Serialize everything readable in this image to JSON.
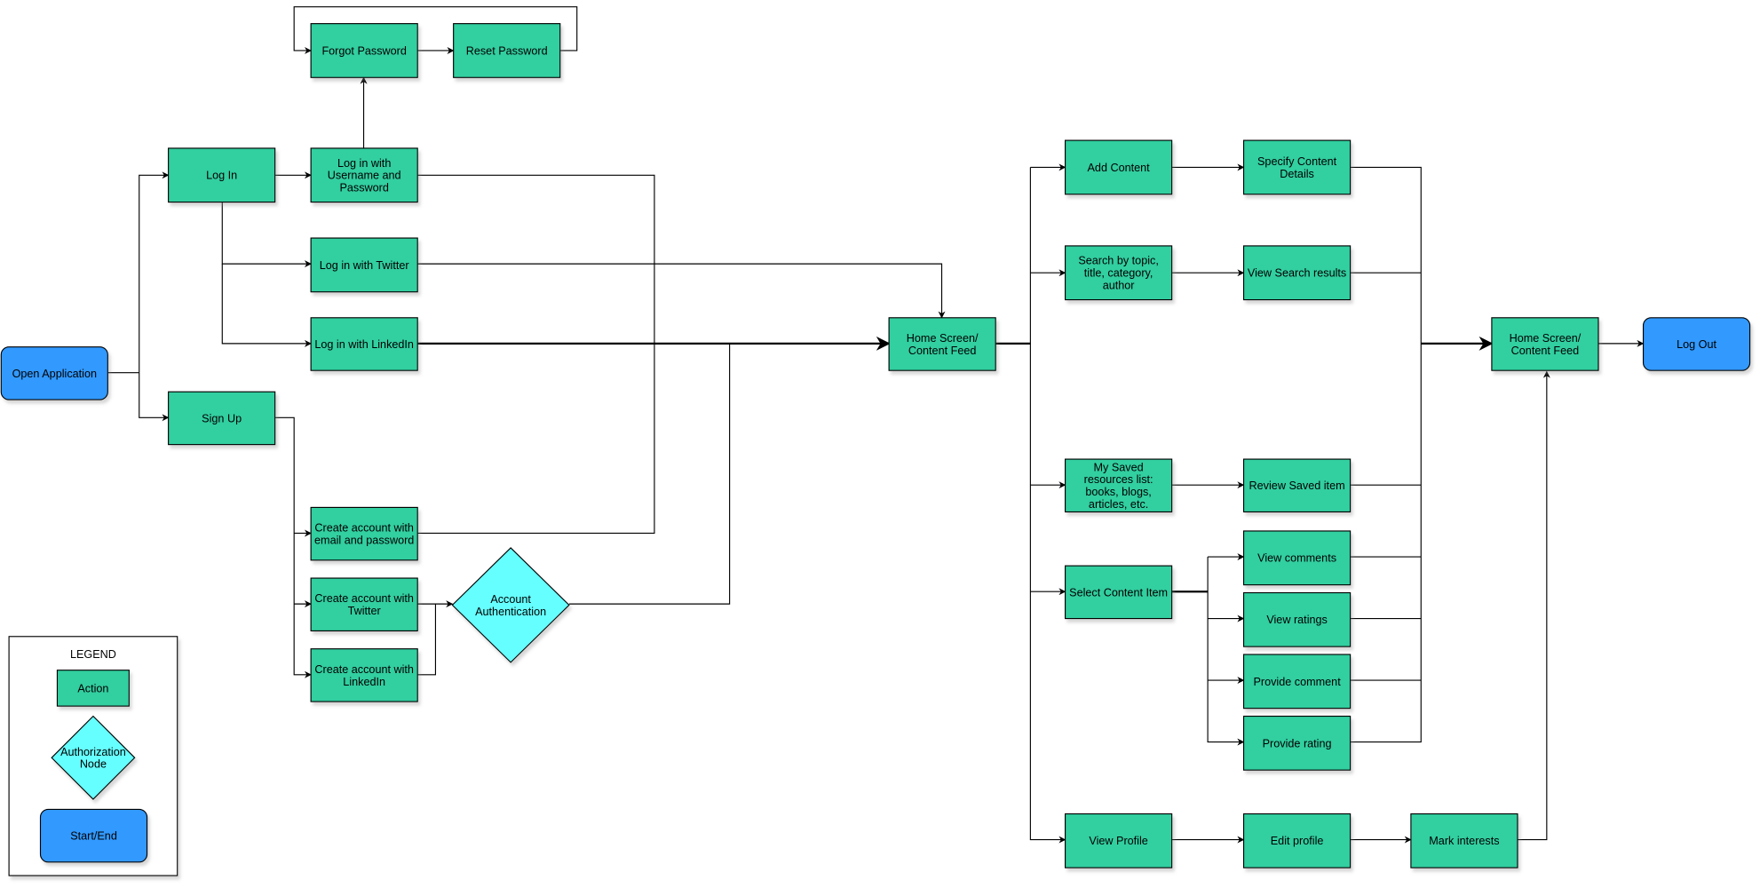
{
  "colors": {
    "action": "#33CFA0",
    "authorization": "#66FFFF",
    "start_end": "#3399FF",
    "edge": "#000000"
  },
  "nodes": {
    "open_application": {
      "type": "start_end",
      "lines": [
        "Open Application"
      ]
    },
    "log_in": {
      "type": "action",
      "lines": [
        "Log In"
      ]
    },
    "sign_up": {
      "type": "action",
      "lines": [
        "Sign Up"
      ]
    },
    "forgot_password": {
      "type": "action",
      "lines": [
        "Forgot Password"
      ]
    },
    "reset_password": {
      "type": "action",
      "lines": [
        "Reset Password"
      ]
    },
    "login_username": {
      "type": "action",
      "lines": [
        "Log in with",
        "Username and",
        "Password"
      ]
    },
    "login_twitter": {
      "type": "action",
      "lines": [
        "Log in with Twitter"
      ]
    },
    "login_linkedin": {
      "type": "action",
      "lines": [
        "Log in with LinkedIn"
      ]
    },
    "create_email": {
      "type": "action",
      "lines": [
        "Create account with",
        "email and password"
      ]
    },
    "create_twitter": {
      "type": "action",
      "lines": [
        "Create account with",
        "Twitter"
      ]
    },
    "create_linkedin": {
      "type": "action",
      "lines": [
        "Create account with",
        "LinkedIn"
      ]
    },
    "account_authentication": {
      "type": "authorization",
      "lines": [
        "Account",
        "Authentication"
      ]
    },
    "home_feed_1": {
      "type": "action",
      "lines": [
        "Home Screen/",
        "Content Feed"
      ]
    },
    "add_content": {
      "type": "action",
      "lines": [
        "Add Content"
      ]
    },
    "specify_details": {
      "type": "action",
      "lines": [
        "Specify Content",
        "Details"
      ]
    },
    "search": {
      "type": "action",
      "lines": [
        "Search by topic,",
        "title, category,",
        "author"
      ]
    },
    "view_search_results": {
      "type": "action",
      "lines": [
        "View Search results"
      ]
    },
    "saved_list": {
      "type": "action",
      "lines": [
        "My Saved",
        "resources list:",
        "books, blogs,",
        "articles, etc."
      ]
    },
    "review_saved": {
      "type": "action",
      "lines": [
        "Review Saved item"
      ]
    },
    "select_content": {
      "type": "action",
      "lines": [
        "Select Content Item"
      ]
    },
    "view_comments": {
      "type": "action",
      "lines": [
        "View comments"
      ]
    },
    "view_ratings": {
      "type": "action",
      "lines": [
        "View ratings"
      ]
    },
    "provide_comment": {
      "type": "action",
      "lines": [
        "Provide comment"
      ]
    },
    "provide_rating": {
      "type": "action",
      "lines": [
        "Provide rating"
      ]
    },
    "view_profile": {
      "type": "action",
      "lines": [
        "View Profile"
      ]
    },
    "edit_profile": {
      "type": "action",
      "lines": [
        "Edit profile"
      ]
    },
    "mark_interests": {
      "type": "action",
      "lines": [
        "Mark interests"
      ]
    },
    "home_feed_2": {
      "type": "action",
      "lines": [
        "Home Screen/",
        "Content Feed"
      ]
    },
    "log_out": {
      "type": "start_end",
      "lines": [
        "Log Out"
      ]
    }
  },
  "legend": {
    "title": "LEGEND",
    "action": {
      "type": "action",
      "lines": [
        "Action"
      ]
    },
    "authorization": {
      "type": "authorization",
      "lines": [
        "Authorization",
        "Node"
      ]
    },
    "start_end": {
      "type": "start_end",
      "lines": [
        "Start/End"
      ]
    }
  }
}
